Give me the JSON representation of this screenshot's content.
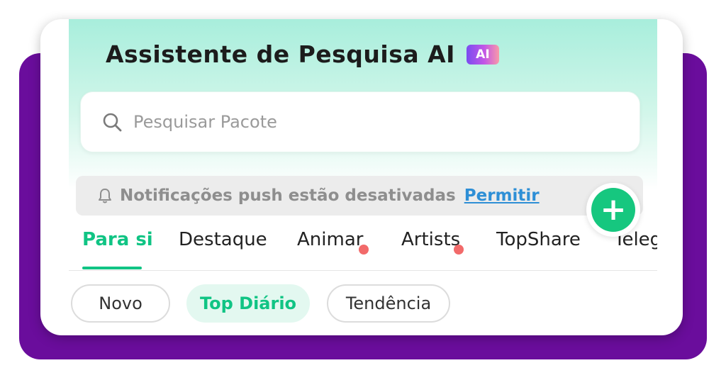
{
  "header": {
    "title": "Assistente de Pesquisa AI",
    "ai_badge": "AI"
  },
  "search": {
    "placeholder": "Pesquisar Pacote",
    "value": ""
  },
  "notification": {
    "message": "Notificações push estão desativadas",
    "action_label": "Permitir"
  },
  "tabs": [
    {
      "label": "Para si",
      "active": true,
      "dot": false
    },
    {
      "label": "Destaque",
      "active": false,
      "dot": false
    },
    {
      "label": "Animar",
      "active": false,
      "dot": true
    },
    {
      "label": "Artists",
      "active": false,
      "dot": true
    },
    {
      "label": "TopShare",
      "active": false,
      "dot": false
    },
    {
      "label": "Teleg",
      "active": false,
      "dot": false
    }
  ],
  "filters": [
    {
      "label": "Novo",
      "active": false
    },
    {
      "label": "Top Diário",
      "active": true
    },
    {
      "label": "Tendência",
      "active": false
    }
  ],
  "fab": {
    "symbol": "+",
    "icon": "plus-icon"
  },
  "colors": {
    "accent": "#10c484",
    "brand_purple": "#6a0d9c",
    "link": "#2e8fd6",
    "dot": "#f26a6a"
  }
}
